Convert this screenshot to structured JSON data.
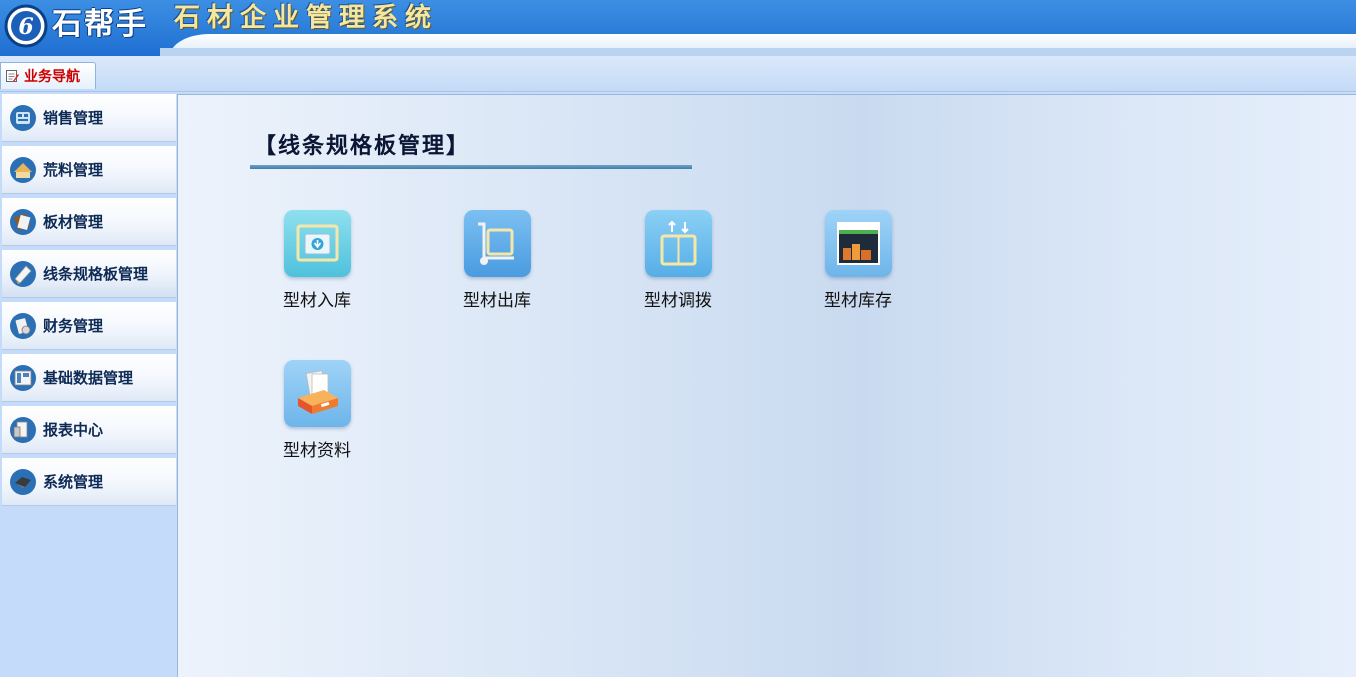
{
  "header": {
    "logo_name": "石帮手",
    "system_title": "石材企业管理系统"
  },
  "tabbar": {
    "nav_tab_label": "业务导航"
  },
  "sidebar": {
    "items": [
      {
        "label": "销售管理",
        "icon": "sales-icon"
      },
      {
        "label": "荒料管理",
        "icon": "raw-material-icon"
      },
      {
        "label": "板材管理",
        "icon": "slab-icon"
      },
      {
        "label": "线条规格板管理",
        "icon": "profile-board-icon",
        "active": true
      },
      {
        "label": "财务管理",
        "icon": "finance-icon"
      },
      {
        "label": "基础数据管理",
        "icon": "base-data-icon"
      },
      {
        "label": "报表中心",
        "icon": "report-icon"
      },
      {
        "label": "系统管理",
        "icon": "system-settings-icon"
      }
    ]
  },
  "main": {
    "section_title": "【线条规格板管理】",
    "apps": [
      {
        "label": "型材入库",
        "icon": "stock-in-icon"
      },
      {
        "label": "型材出库",
        "icon": "stock-out-icon"
      },
      {
        "label": "型材调拨",
        "icon": "transfer-icon"
      },
      {
        "label": "型材库存",
        "icon": "inventory-icon"
      },
      {
        "label": "型材资料",
        "icon": "profile-info-icon"
      }
    ]
  },
  "colors": {
    "header_blue": "#1f6fd2",
    "title_gold": "#f3e7a4",
    "tab_text_red": "#cc0000",
    "sidebar_text": "#0d2a55"
  }
}
